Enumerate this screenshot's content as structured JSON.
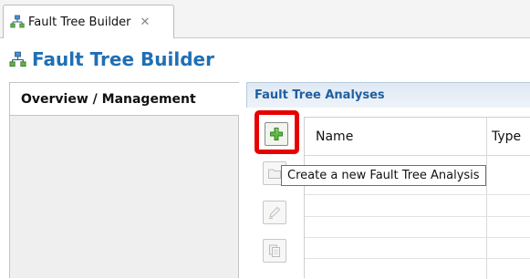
{
  "editor_tab": {
    "label": "Fault Tree Builder",
    "close_glyph": "✕",
    "icon": "fault-tree-icon"
  },
  "header": {
    "title": "Fault Tree Builder",
    "icon": "fault-tree-icon",
    "title_color": "#1f6fb5"
  },
  "left_panel": {
    "tab_label": "Overview / Management"
  },
  "section": {
    "title": "Fault Tree Analyses",
    "title_color": "#1f5fa0"
  },
  "toolbar": {
    "buttons": [
      {
        "name": "add",
        "icon": "plus-icon",
        "enabled": true,
        "highlighted": true,
        "highlight_color": "#e60000"
      },
      {
        "name": "open",
        "icon": "folder-icon",
        "enabled": false
      },
      {
        "name": "edit",
        "icon": "pencil-icon",
        "enabled": false
      },
      {
        "name": "copy",
        "icon": "copy-icon",
        "enabled": false
      }
    ]
  },
  "table": {
    "columns": [
      "Name",
      "Type"
    ],
    "rows": []
  },
  "tooltip": {
    "text": "Create a new Fault Tree Analysis"
  }
}
